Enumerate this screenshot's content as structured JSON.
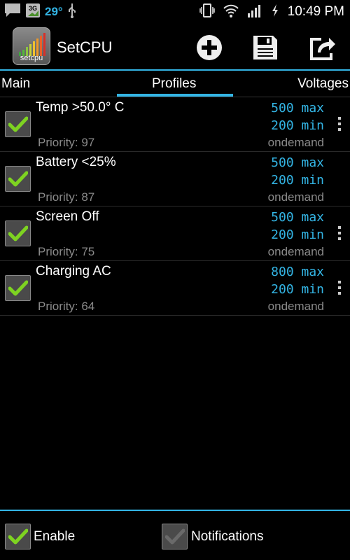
{
  "status_bar": {
    "temperature": "29°",
    "network_badge": "3G",
    "time": "10:49 PM",
    "icons": [
      "chat-icon",
      "network-3g-icon",
      "usb-icon",
      "vibrate-icon",
      "wifi-icon",
      "signal-icon",
      "charging-icon"
    ]
  },
  "action_bar": {
    "app_icon_label": "setcpu",
    "title": "SetCPU",
    "buttons": [
      "add-profile-icon",
      "save-icon",
      "load-icon"
    ]
  },
  "tabs": [
    {
      "label": "Main",
      "selected": false
    },
    {
      "label": "Profiles",
      "selected": true
    },
    {
      "label": "Voltages",
      "selected": false
    }
  ],
  "profiles": [
    {
      "name": "Temp >50.0° C",
      "max": "500 max",
      "min": "200 min",
      "priority": "Priority: 97",
      "governor": "ondemand",
      "enabled": true
    },
    {
      "name": "Battery <25%",
      "max": "500 max",
      "min": "200 min",
      "priority": "Priority: 87",
      "governor": "ondemand",
      "enabled": true
    },
    {
      "name": "Screen Off",
      "max": "500 max",
      "min": "200 min",
      "priority": "Priority: 75",
      "governor": "ondemand",
      "enabled": true
    },
    {
      "name": "Charging AC",
      "max": "800 max",
      "min": "200 min",
      "priority": "Priority: 64",
      "governor": "ondemand",
      "enabled": true
    }
  ],
  "bottom_bar": {
    "enable_label": "Enable",
    "enable_checked": true,
    "notifications_label": "Notifications",
    "notifications_checked": false
  },
  "colors": {
    "accent": "#33b5e5",
    "check_green": "#7ed321",
    "background": "#000000",
    "secondary_text": "#8a8a8a"
  }
}
